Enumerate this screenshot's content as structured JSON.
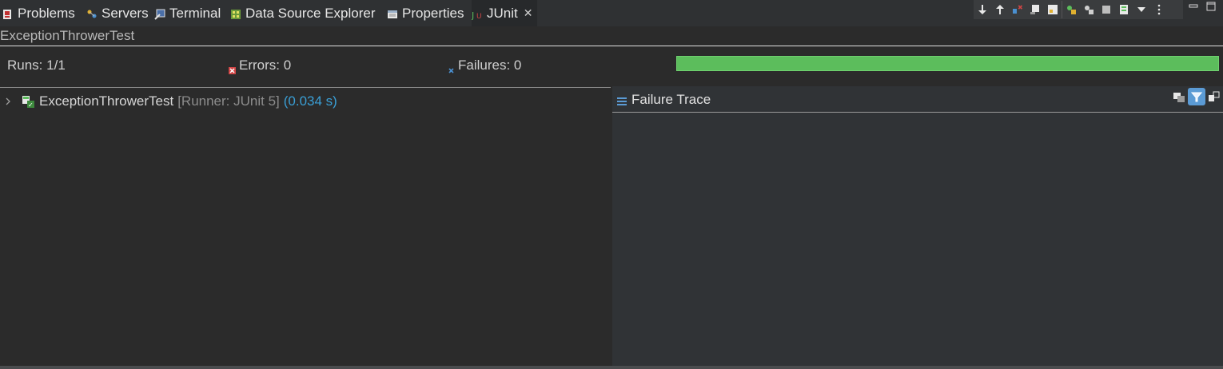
{
  "tabs": [
    {
      "label": "Problems",
      "icon": "problems-icon"
    },
    {
      "label": "Servers",
      "icon": "servers-icon"
    },
    {
      "label": "Terminal",
      "icon": "terminal-icon"
    },
    {
      "label": "Data Source Explorer",
      "icon": "data-source-explorer-icon"
    },
    {
      "label": "Properties",
      "icon": "properties-icon"
    },
    {
      "label": "JUnit",
      "icon": "junit-icon",
      "close": "✕"
    }
  ],
  "toolbar_icons": [
    "next-failure-icon",
    "previous-failure-icon",
    "failures-only-icon",
    "scroll-lock-icon",
    "show-skipped-icon",
    "rerun-icon",
    "rerun-failed-first-icon",
    "stop-icon",
    "history-icon",
    "view-menu-chevron-icon",
    "more-options-icon"
  ],
  "window_controls": {
    "minimize": "▭",
    "maximize": "□"
  },
  "view_title": "ExceptionThrowerTest",
  "counters": {
    "runs_label": "Runs:",
    "runs_value": "1/1",
    "errors_label": "Errors:",
    "errors_value": "0",
    "failures_label": "Failures:",
    "failures_value": "0"
  },
  "progress": {
    "fraction": 1.0,
    "color": "#5cbd5c"
  },
  "tree": {
    "name": "ExceptionThrowerTest",
    "runner": "[Runner: JUnit 5]",
    "time": "(0.034 s)"
  },
  "failure_trace": {
    "title": "Failure Trace",
    "tools": [
      "compare-results-icon",
      "filter-stack-trace-icon",
      "copy-trace-icon"
    ]
  },
  "colors": {
    "accent": "#3a9fd6",
    "success": "#5cbd5c",
    "error": "#d04545"
  }
}
